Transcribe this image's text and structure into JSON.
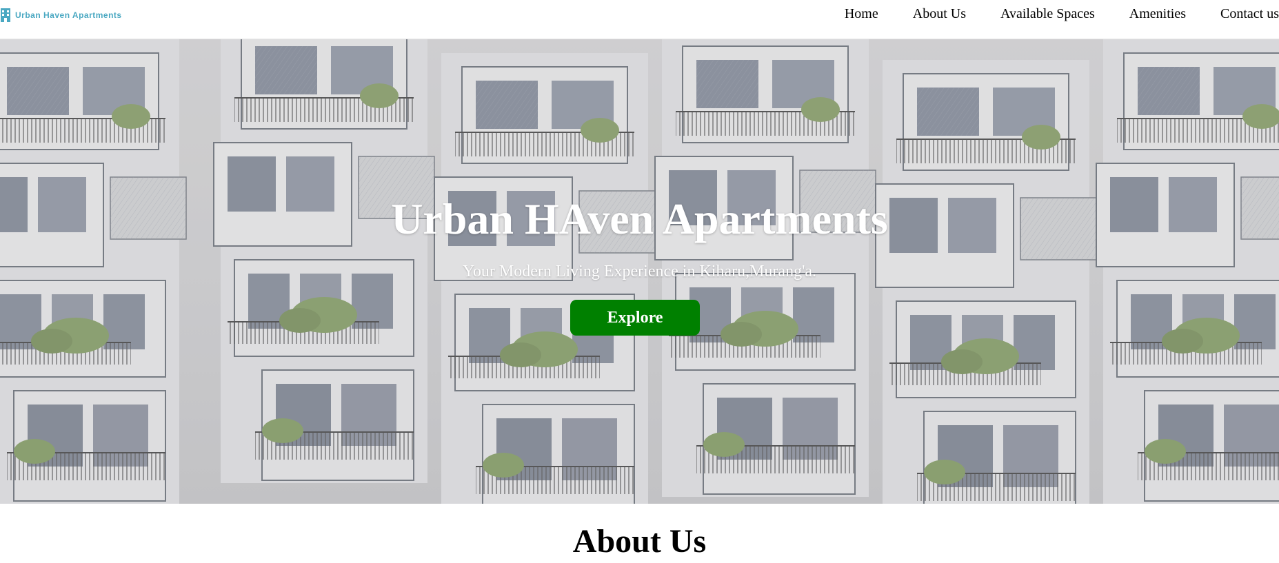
{
  "header": {
    "logo_text": "Urban Haven Apartments",
    "logo_icon": "building-icon",
    "nav": {
      "home": "Home",
      "about": "About Us",
      "spaces": "Available Spaces",
      "amenities": "Amenities",
      "contact": "Contact us"
    }
  },
  "hero": {
    "title": "Urban HAven Apartments",
    "subtitle": "Your Modern Living Experience in Kiharu,Murang'a.",
    "button_label": "Explore",
    "button_color": "#008000"
  },
  "about": {
    "heading": "About Us"
  },
  "colors": {
    "logo_accent": "#4aa8c2",
    "button": "#008000"
  }
}
